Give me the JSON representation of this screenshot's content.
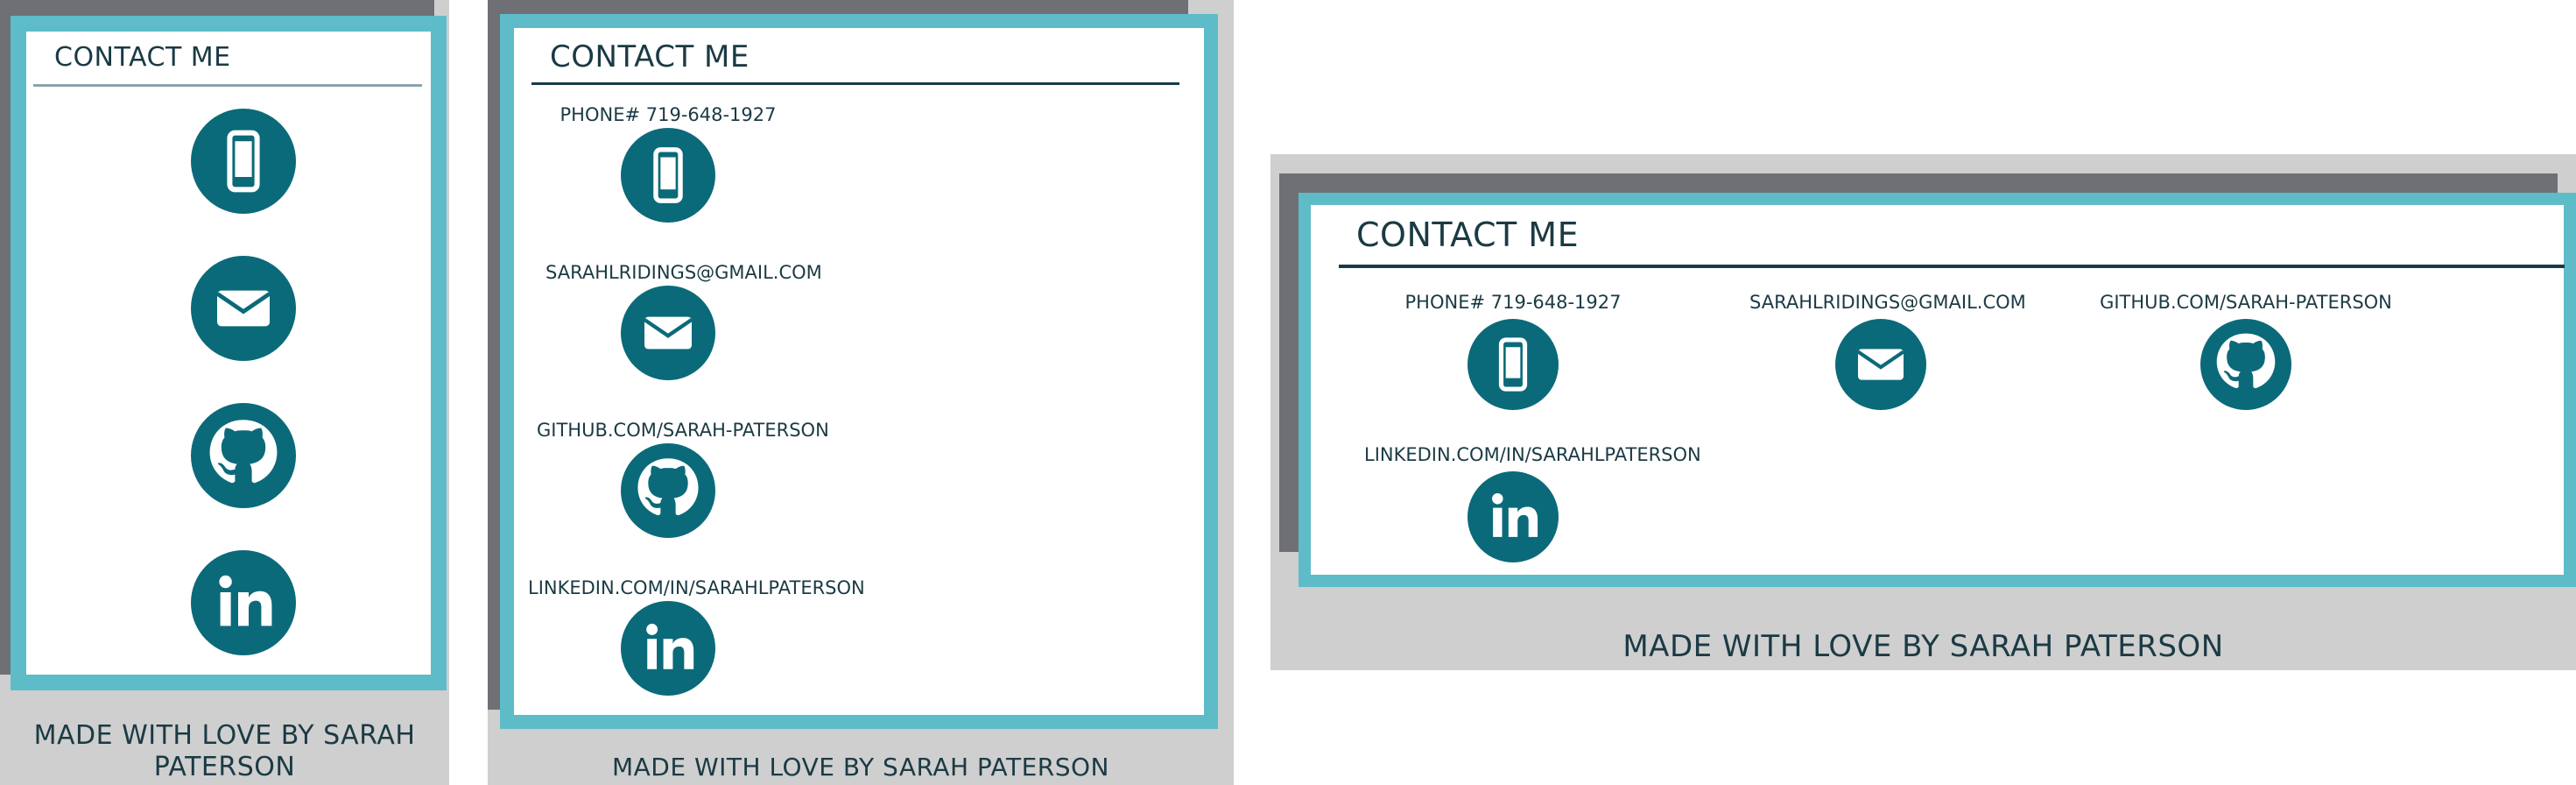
{
  "contact": {
    "title": "CONTACT ME",
    "phone": "PHONE# 719-648-1927",
    "email": "SARAHLRIDINGS@GMAIL.COM",
    "github": "GITHUB.COM/SARAH-PATERSON",
    "linkedin": "LINKEDIN.COM/IN/SARAHLPATERSON"
  },
  "footer": {
    "text": "MADE WITH LOVE BY SARAH PATERSON"
  },
  "icons": {
    "phone": "phone-icon",
    "email": "envelope-icon",
    "github": "github-icon",
    "linkedin": "linkedin-icon"
  },
  "colors": {
    "accent": "#5dbcc8",
    "icon_bg": "#0b6a79",
    "text": "#1b3a44",
    "panel_bg": "#cfcfcf",
    "shadow": "#6e7075"
  }
}
